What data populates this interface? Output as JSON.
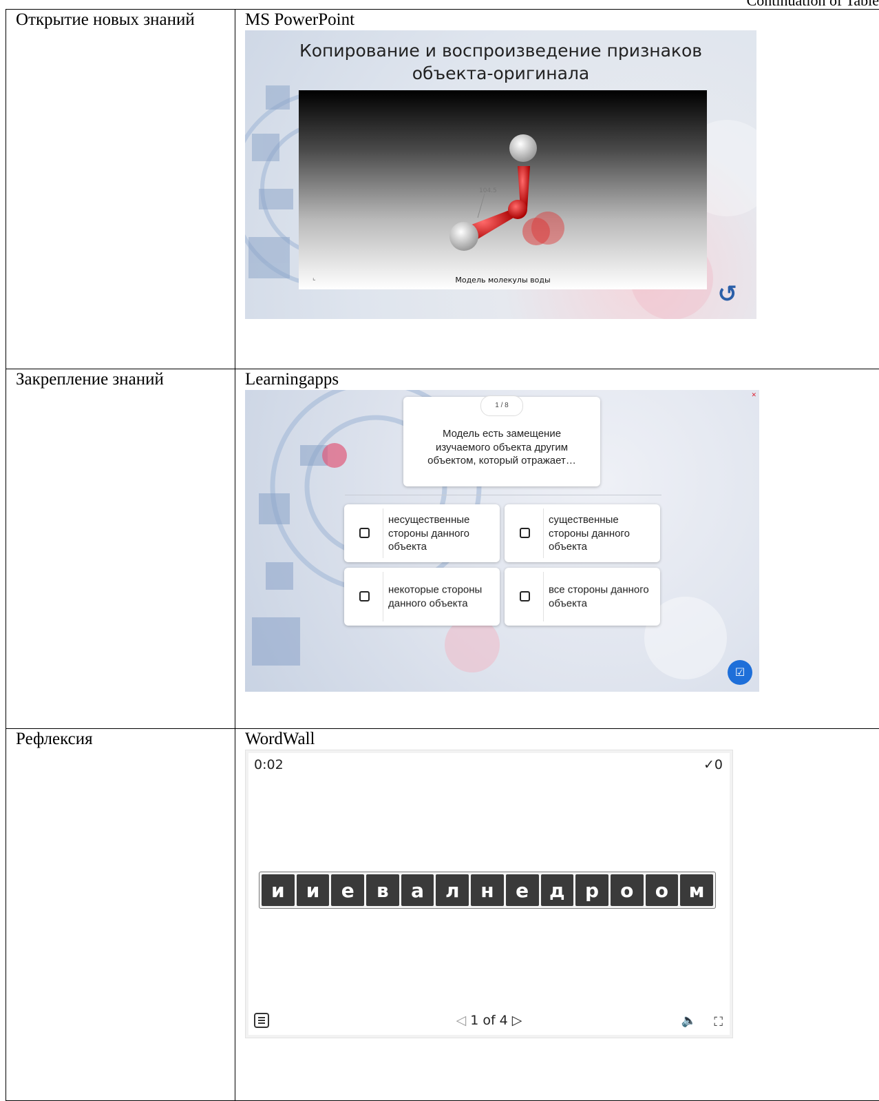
{
  "header": {
    "continuation": "Continuation of Table"
  },
  "rows": [
    {
      "stage": "Открытие новых знаний",
      "tool": "MS PowerPoint",
      "slide": {
        "title_bold": "Копирование и воспроизведение",
        "title_rest": " признаков",
        "title_line2": "объекта-оригинала",
        "molecule_label": "104.5",
        "caption": "Модель молекулы воды",
        "back_icon": "return-arrow-icon"
      }
    },
    {
      "stage": "Закрепление знаний",
      "tool": "Learningapps",
      "quiz": {
        "counter": "1 / 8",
        "question": "Модель есть замещение изучаемого объекта другим объектом, который отражает…",
        "options": [
          "несущественные стороны данного объекта",
          "существенные стороны данного объекта",
          "некоторые стороны данного объекта",
          "все стороны данного объекта"
        ]
      }
    },
    {
      "stage": "Рефлексия",
      "tool": "WordWall",
      "game": {
        "timer": "0:02",
        "score": "✓0",
        "letters": [
          "и",
          "и",
          "е",
          "в",
          "а",
          "л",
          "н",
          "е",
          "д",
          "р",
          "о",
          "о",
          "м"
        ],
        "page": "1 of 4"
      }
    }
  ]
}
